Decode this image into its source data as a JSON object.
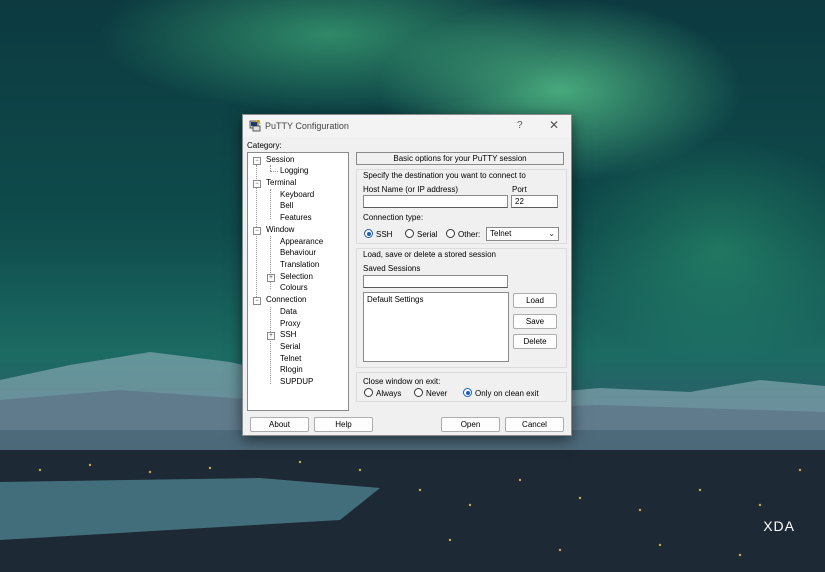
{
  "window": {
    "title": "PuTTY Configuration",
    "help_glyph": "?",
    "close_glyph": "✕"
  },
  "category": {
    "label": "Category:",
    "items": [
      {
        "label": "Session",
        "expander": "−"
      },
      {
        "label": "Logging"
      },
      {
        "label": "Terminal",
        "expander": "−"
      },
      {
        "label": "Keyboard"
      },
      {
        "label": "Bell"
      },
      {
        "label": "Features"
      },
      {
        "label": "Window",
        "expander": "−"
      },
      {
        "label": "Appearance"
      },
      {
        "label": "Behaviour"
      },
      {
        "label": "Translation"
      },
      {
        "label": "Selection",
        "expander": "+"
      },
      {
        "label": "Colours"
      },
      {
        "label": "Connection",
        "expander": "−"
      },
      {
        "label": "Data"
      },
      {
        "label": "Proxy"
      },
      {
        "label": "SSH",
        "expander": "+"
      },
      {
        "label": "Serial"
      },
      {
        "label": "Telnet"
      },
      {
        "label": "Rlogin"
      },
      {
        "label": "SUPDUP"
      }
    ]
  },
  "session": {
    "header": "Basic options for your PuTTY session",
    "destination_label": "Specify the destination you want to connect to",
    "host_label": "Host Name (or IP address)",
    "host_value": "",
    "port_label": "Port",
    "port_value": "22",
    "conn_type_label": "Connection type:",
    "conn_options": {
      "ssh": "SSH",
      "serial": "Serial",
      "other": "Other:"
    },
    "conn_selected": "SSH",
    "other_protocol": "Telnet",
    "sessions_group_label": "Load, save or delete a stored session",
    "saved_sessions_label": "Saved Sessions",
    "saved_session_value": "",
    "sessions_list": [
      "Default Settings"
    ],
    "load_label": "Load",
    "save_label": "Save",
    "delete_label": "Delete",
    "close_label": "Close window on exit:",
    "close_options": {
      "always": "Always",
      "never": "Never",
      "clean": "Only on clean exit"
    },
    "close_selected": "Only on clean exit"
  },
  "footer": {
    "about_label": "About",
    "help_label": "Help",
    "open_label": "Open",
    "cancel_label": "Cancel"
  },
  "watermark": "XDA",
  "colors": {
    "accent": "#1a5fb4",
    "dialog_bg": "#f0f0f0"
  }
}
